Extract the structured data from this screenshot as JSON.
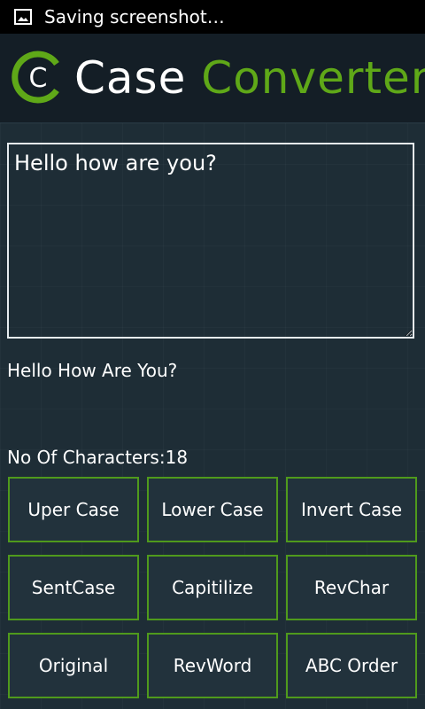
{
  "status_bar": {
    "icon": "image-icon",
    "text": "Saving screenshot…"
  },
  "header": {
    "logo_letter": "C",
    "title_part1": "Case",
    "title_part2": "Converter"
  },
  "colors": {
    "accent": "#5fa818",
    "button_border": "#4f9a1c",
    "background": "#1e2d36"
  },
  "input": {
    "value": "Hello how are you?"
  },
  "output": {
    "text": "Hello How Are You?"
  },
  "char_count": {
    "label": "No Of Characters:",
    "value": "18"
  },
  "buttons": [
    "Uper Case",
    "Lower Case",
    "Invert Case",
    "SentCase",
    "Capitilize",
    "RevChar",
    "Original",
    "RevWord",
    "ABC Order"
  ]
}
